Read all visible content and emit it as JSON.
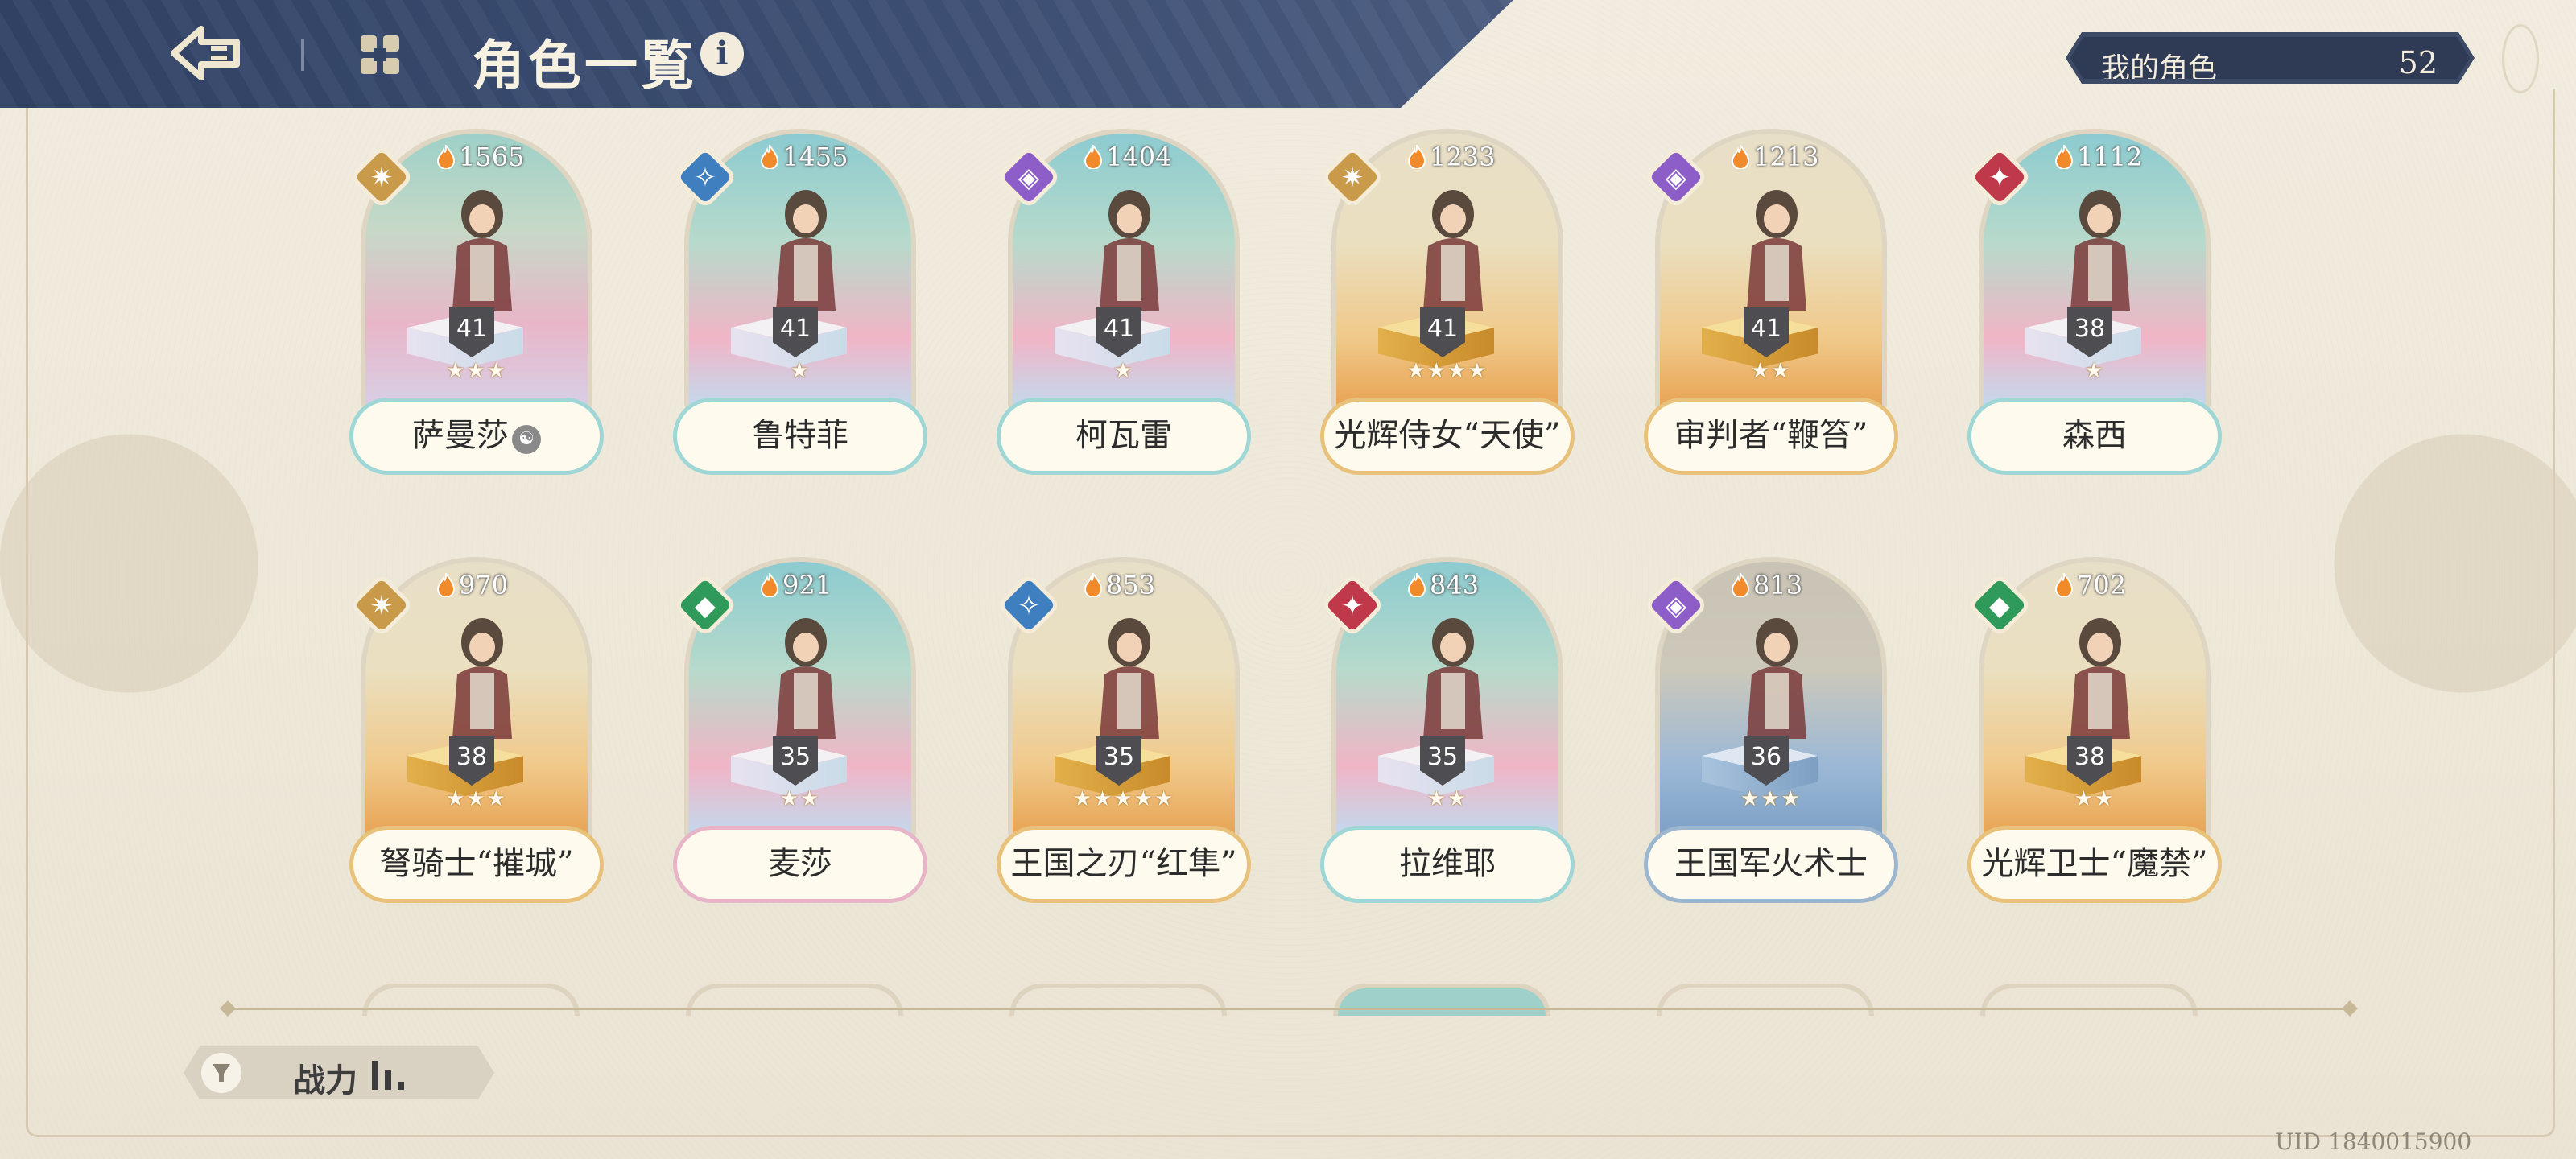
{
  "header": {
    "title": "角色一覧",
    "info_icon": "info-icon",
    "back_icon": "back-arrow-icon",
    "menu_icon": "grid-menu-icon"
  },
  "counter": {
    "label": "我的角色",
    "value": "52"
  },
  "characters": [
    {
      "name": "萨曼莎",
      "power": "1565",
      "level": "41",
      "stars": "★★★",
      "attribute": "sun",
      "attr_color": "#c89a4a",
      "spirit": "☯"
    },
    {
      "name": "鲁特菲",
      "power": "1455",
      "level": "41",
      "stars": "★",
      "attribute": "wind",
      "attr_color": "#3f7fbf"
    },
    {
      "name": "柯瓦雷",
      "power": "1404",
      "level": "41",
      "stars": "★",
      "attribute": "dark",
      "attr_color": "#8e5ec8"
    },
    {
      "name": "光辉侍女“天使”",
      "power": "1233",
      "level": "41",
      "stars": "★★★★",
      "attribute": "sun",
      "attr_color": "#c89a4a"
    },
    {
      "name": "审判者“鞭笞”",
      "power": "1213",
      "level": "41",
      "stars": "★★",
      "attribute": "dark",
      "attr_color": "#8e5ec8"
    },
    {
      "name": "森西",
      "power": "1112",
      "level": "38",
      "stars": "★",
      "attribute": "fire",
      "attr_color": "#c0394a"
    },
    {
      "name": "弩骑士“摧城”",
      "power": "970",
      "level": "38",
      "stars": "★★★",
      "attribute": "sun",
      "attr_color": "#c89a4a"
    },
    {
      "name": "麦莎",
      "power": "921",
      "level": "35",
      "stars": "★★",
      "attribute": "earth",
      "attr_color": "#2f9a5a"
    },
    {
      "name": "王国之刃“红隼”",
      "power": "853",
      "level": "35",
      "stars": "★★★★★",
      "attribute": "wind",
      "attr_color": "#3f7fbf"
    },
    {
      "name": "拉维耶",
      "power": "843",
      "level": "35",
      "stars": "★★",
      "attribute": "fire",
      "attr_color": "#c0394a"
    },
    {
      "name": "王国军火术士",
      "power": "813",
      "level": "36",
      "stars": "★★★",
      "attribute": "dark",
      "attr_color": "#8e5ec8"
    },
    {
      "name": "光辉卫士“魔禁”",
      "power": "702",
      "level": "38",
      "stars": "★★",
      "attribute": "earth",
      "attr_color": "#2f9a5a"
    }
  ],
  "sort": {
    "label": "战力",
    "icon": "filter-icon",
    "order_icon": "sort-bars-icon"
  },
  "uid": "UID 1840015900"
}
